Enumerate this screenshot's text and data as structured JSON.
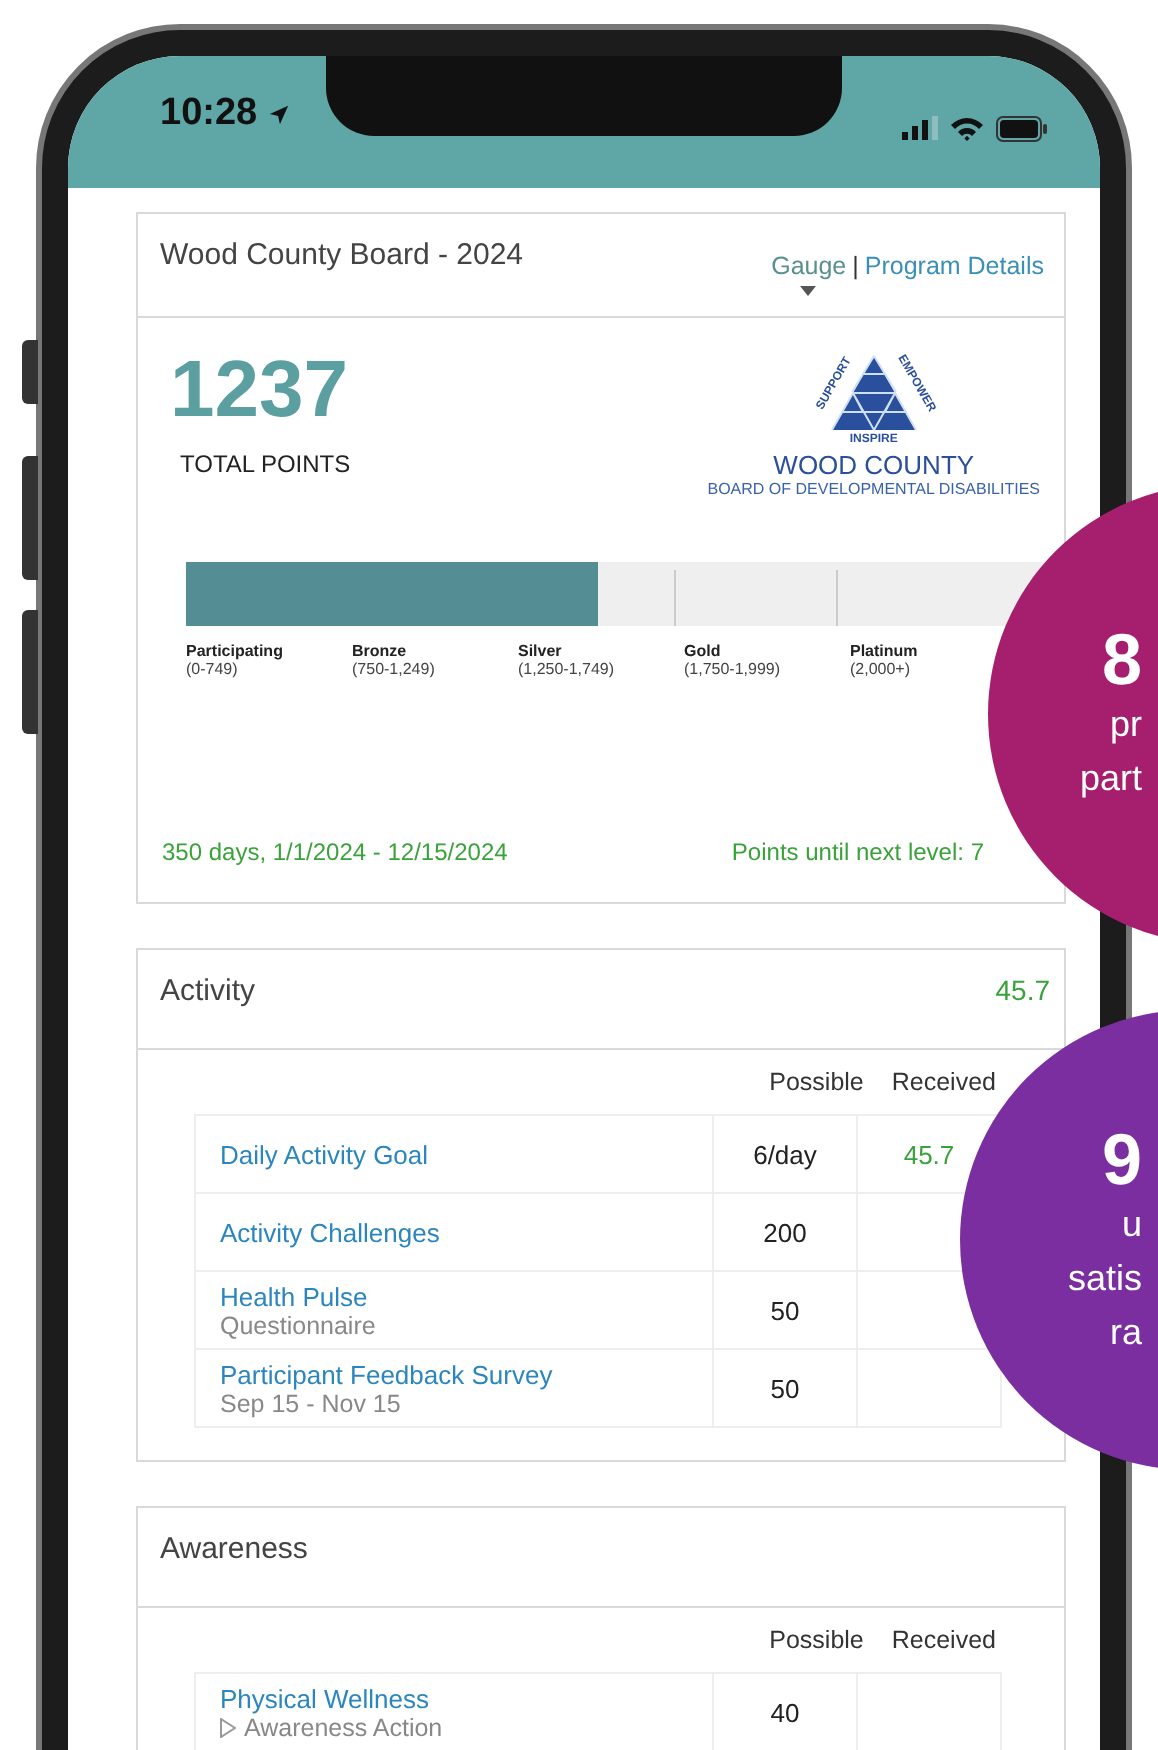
{
  "status_bar": {
    "time": "10:28"
  },
  "program": {
    "title": "Wood County Board - 2024",
    "separator": "|",
    "links": [
      {
        "label": "Gauge",
        "selected": true
      },
      {
        "label": "Program Details",
        "selected": false
      }
    ]
  },
  "total": {
    "value": "1237",
    "label": "TOTAL POINTS"
  },
  "logo": {
    "arc_left": "SUPPORT",
    "arc_right": "EMPOWER",
    "base": "INSPIRE",
    "name": "WOOD COUNTY",
    "subtitle": "BOARD OF DEVELOPMENTAL DISABILITIES"
  },
  "progress": {
    "level": 0.47,
    "tiers": [
      {
        "name": "Participating",
        "range": "(0-749)"
      },
      {
        "name": "Bronze",
        "range": "(750-1,249)"
      },
      {
        "name": "Silver",
        "range": "(1,250-1,749)"
      },
      {
        "name": "Gold",
        "range": "(1,750-1,999)"
      },
      {
        "name": "Platinum",
        "range": "(2,000+)"
      }
    ]
  },
  "period": "350 days, 1/1/2024 - 12/15/2024",
  "next_level": "Points until next level: 7",
  "sections": [
    {
      "title": "Activity",
      "score": "45.7",
      "columns": [
        "Possible",
        "Received"
      ],
      "rows": [
        {
          "name": "Daily Activity Goal",
          "possible": "6/day",
          "received": "45.7"
        },
        {
          "name": "Activity Challenges",
          "possible": "200"
        },
        {
          "name": "Health Pulse",
          "sub": "Questionnaire",
          "possible": "50"
        },
        {
          "name": "Participant Feedback Survey",
          "sub": "Sep 15 - Nov 15",
          "possible": "50"
        }
      ]
    },
    {
      "title": "Awareness",
      "columns": [
        "Possible",
        "Received"
      ],
      "rows": [
        {
          "name": "Physical Wellness",
          "sub": "Awareness Action",
          "sub_icon": true,
          "possible": "40"
        }
      ]
    }
  ],
  "callouts": [
    {
      "color": "#a61f6e",
      "lines": [
        "8",
        "pr",
        "part"
      ]
    },
    {
      "color": "#7b2e9f",
      "lines": [
        "9",
        "u",
        "satis",
        "ra"
      ]
    }
  ]
}
